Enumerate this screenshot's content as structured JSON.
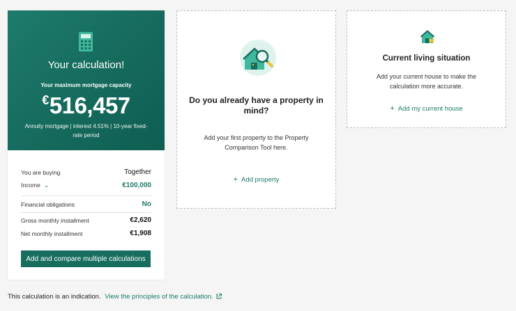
{
  "calculation": {
    "title": "Your calculation!",
    "subtitle": "Your maximum mortgage capacity",
    "currency_symbol": "€",
    "amount": "516,457",
    "note": "Annuity mortgage | interest 4.51% | 10-year fixed-rate period",
    "rows": [
      {
        "label": "You are buying",
        "value": "Together"
      },
      {
        "label": "Income",
        "value": "€100,000"
      },
      {
        "label": "Financial obligations",
        "value": "No"
      },
      {
        "label": "Gross monthly installment",
        "value": "€2,620"
      },
      {
        "label": "Net monthly installment",
        "value": "€1,908"
      }
    ],
    "cta_label": "Add and compare multiple calculations"
  },
  "property_card": {
    "title": "Do you already have a property in mind?",
    "description": "Add your first property to the Property Comparison Tool here.",
    "link_label": "Add property"
  },
  "house_card": {
    "title": "Current living situation",
    "description": "Add your current house to make the calculation more accurate.",
    "link_label": "Add my current house"
  },
  "footer": {
    "text": "This calculation is an indication.",
    "link_label": "View the principles of the calculation."
  },
  "icons": {
    "calculator": "calculator-icon",
    "property_search": "house-search-icon",
    "house": "house-icon",
    "external": "external-link-icon",
    "chevron": "chevron-down-icon",
    "plus": "plus-icon"
  },
  "colors": {
    "brand": "#176e5f",
    "hero_gradient_start": "#1e7b6c",
    "hero_gradient_end": "#0f5e52",
    "link": "#1a7a68",
    "icon_accent": "#f2c12e"
  }
}
